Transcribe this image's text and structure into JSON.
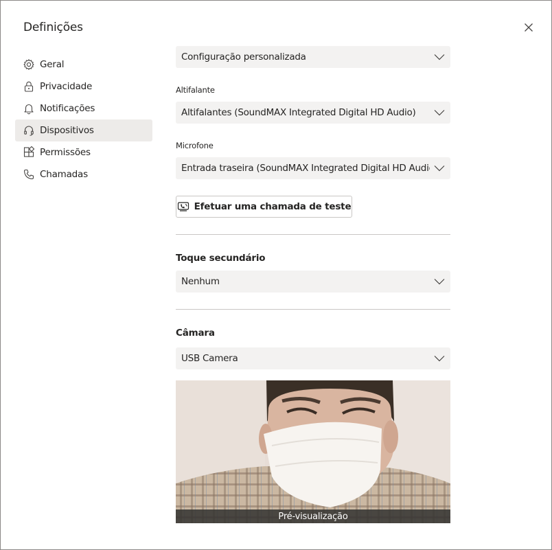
{
  "dialog": {
    "title": "Definições"
  },
  "nav": {
    "items": [
      {
        "id": "geral",
        "label": "Geral",
        "icon": "gear-icon"
      },
      {
        "id": "privacidade",
        "label": "Privacidade",
        "icon": "lock-icon"
      },
      {
        "id": "notificacoes",
        "label": "Notificações",
        "icon": "bell-icon"
      },
      {
        "id": "dispositivos",
        "label": "Dispositivos",
        "icon": "headset-icon",
        "active": true
      },
      {
        "id": "permissoes",
        "label": "Permissões",
        "icon": "puzzle-icon"
      },
      {
        "id": "chamadas",
        "label": "Chamadas",
        "icon": "phone-icon"
      }
    ]
  },
  "devices": {
    "audio_config": {
      "value": "Configuração personalizada"
    },
    "speaker": {
      "label": "Altifalante",
      "value": "Altifalantes (SoundMAX Integrated Digital HD Audio)"
    },
    "microphone": {
      "label": "Microfone",
      "value": "Entrada traseira (SoundMAX Integrated Digital HD Audio)"
    },
    "test_call_label": "Efetuar uma chamada de teste",
    "secondary_ringer": {
      "title": "Toque secundário",
      "value": "Nenhum"
    },
    "camera": {
      "title": "Câmara",
      "value": "USB Camera",
      "preview_caption": "Pré-visualização"
    }
  },
  "colors": {
    "active_nav_bg": "#edebe9",
    "dropdown_bg": "#f3f2f1",
    "divider": "#c8c6c4",
    "text": "#252423"
  }
}
